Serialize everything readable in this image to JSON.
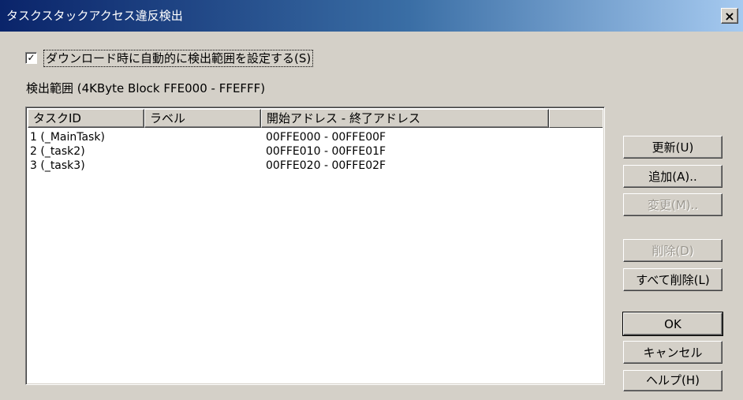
{
  "window": {
    "title": "タスクスタックアクセス違反検出",
    "close_glyph": "×"
  },
  "checkbox": {
    "checked": true,
    "mark": "✓",
    "label": "ダウンロード時に自動的に検出範囲を設定する(S)"
  },
  "range_label": "検出範囲 (4KByte Block  FFE000 - FFEFFF)",
  "table": {
    "columns": [
      "タスクID",
      "ラベル",
      "開始アドレス - 終了アドレス",
      ""
    ],
    "rows": [
      {
        "task_id": "1 (_MainTask)",
        "label": "",
        "address": "00FFE000 - 00FFE00F"
      },
      {
        "task_id": "2 (_task2)",
        "label": "",
        "address": "00FFE010 - 00FFE01F"
      },
      {
        "task_id": "3 (_task3)",
        "label": "",
        "address": "00FFE020 - 00FFE02F"
      }
    ]
  },
  "buttons": {
    "update": "更新(U)",
    "add": "追加(A)..",
    "change": "変更(M)..",
    "delete": "削除(D)",
    "delete_all": "すべて削除(L)",
    "ok": "OK",
    "cancel": "キャンセル",
    "help": "ヘルプ(H)"
  },
  "button_states": {
    "change_enabled": false,
    "delete_enabled": false,
    "default_button": "ok"
  }
}
